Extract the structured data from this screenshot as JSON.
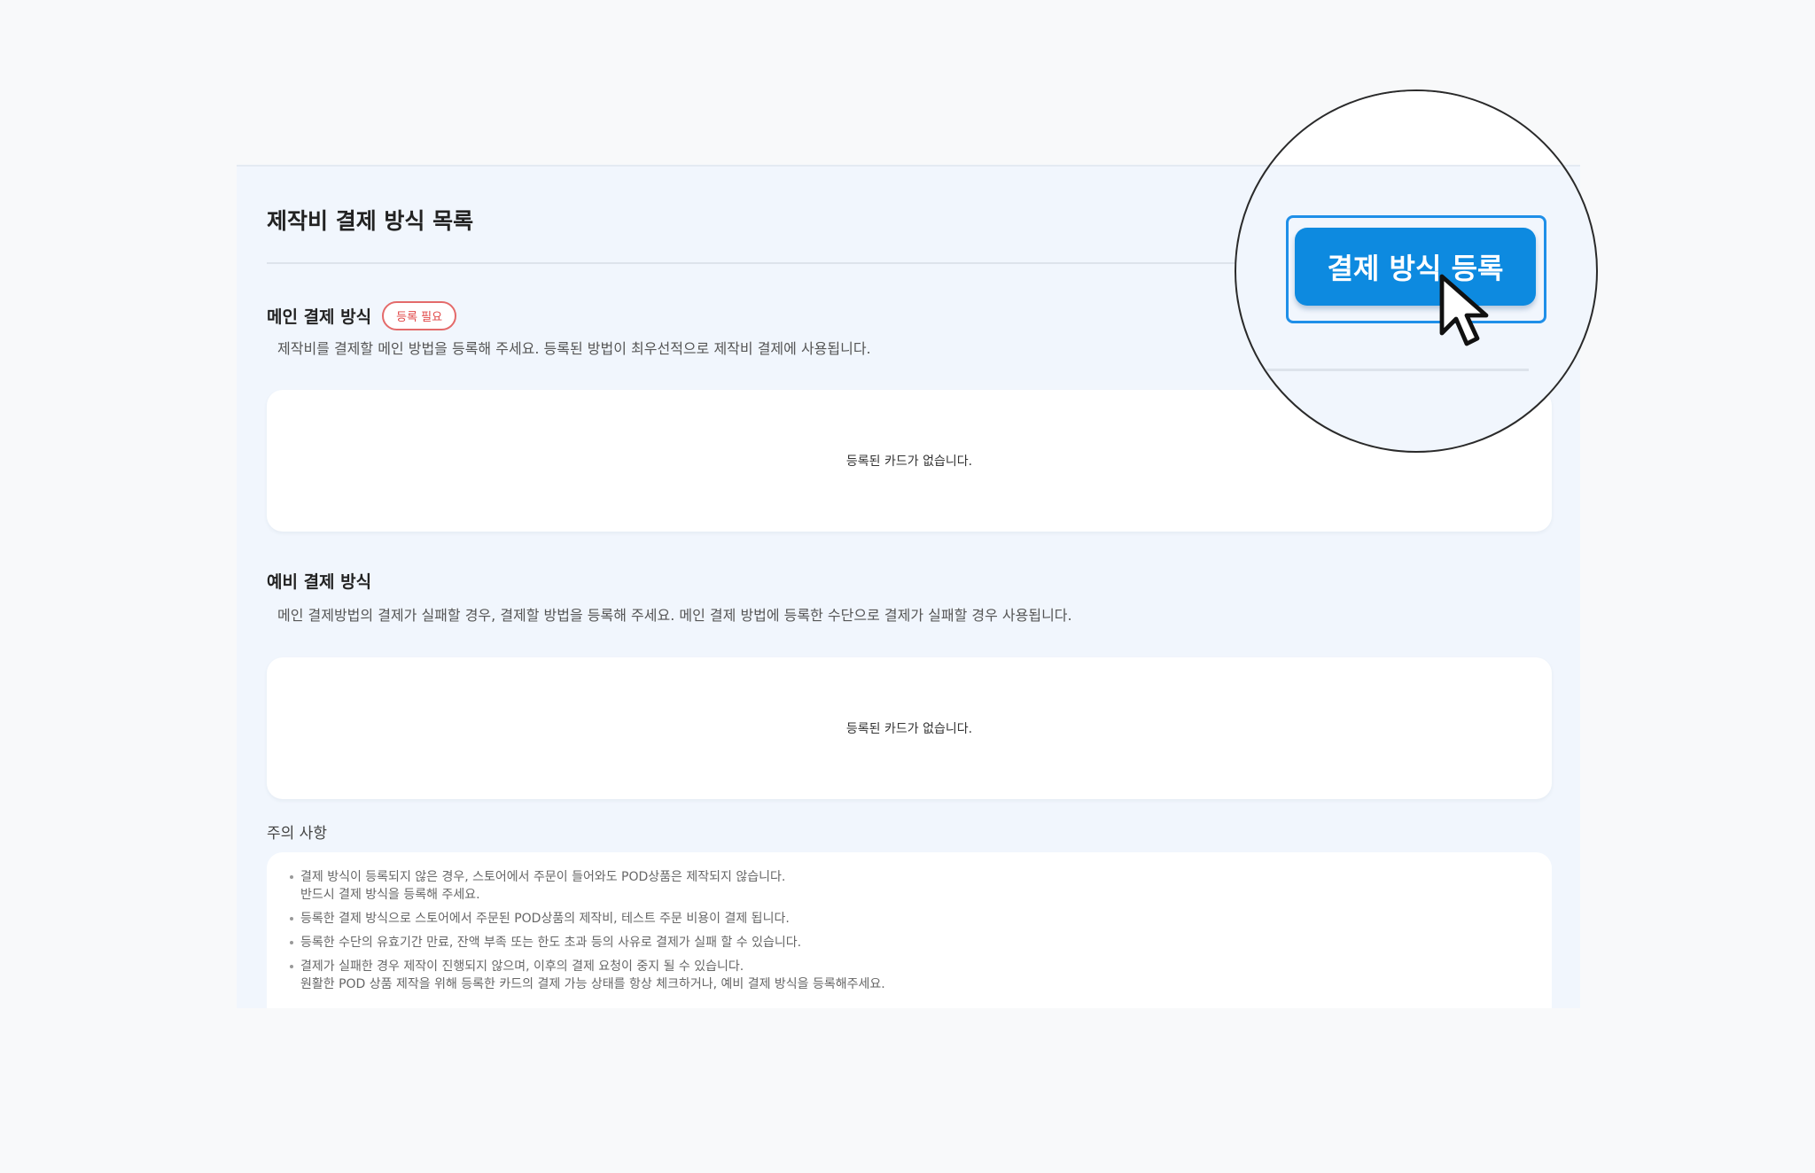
{
  "page": {
    "title": "제작비 결제 방식 목록"
  },
  "main_payment": {
    "heading": "메인 결제 방식",
    "badge": "등록 필요",
    "description": "제작비를 결제할 메인 방법을 등록해 주세요. 등록된 방법이 최우선적으로 제작비 결제에 사용됩니다.",
    "empty_text": "등록된 카드가 없습니다."
  },
  "backup_payment": {
    "heading": "예비 결제 방식",
    "description": "메인 결제방법의 결제가 실패할 경우, 결제할 방법을 등록해 주세요. 메인 결제 방법에 등록한 수단으로 결제가 실패할 경우 사용됩니다.",
    "empty_text": "등록된 카드가 없습니다."
  },
  "notice": {
    "title": "주의 사항",
    "items": [
      [
        "결제 방식이 등록되지 않은 경우, 스토어에서 주문이 들어와도 POD상품은 제작되지 않습니다.",
        "반드시 결제 방식을 등록해 주세요."
      ],
      [
        "등록한 결제 방식으로 스토어에서 주문된 POD상품의 제작비, 테스트 주문 비용이 결제 됩니다."
      ],
      [
        "등록한 수단의 유효기간 만료, 잔액 부족 또는 한도 초과 등의 사유로 결제가 실패 할 수 있습니다."
      ],
      [
        "결제가 실패한 경우 제작이 진행되지 않으며, 이후의 결제 요청이 중지 될 수 있습니다.",
        "원활한 POD 상품 제작을 위해 등록한 카드의 결제 가능 상태를 항상 체크하거나, 예비 결제 방식을 등록해주세요."
      ]
    ]
  },
  "action": {
    "register_label": "결제 방식 등록",
    "accent_color": "#0d8ae0"
  },
  "icons": {
    "cursor": "mouse-pointer-icon"
  }
}
